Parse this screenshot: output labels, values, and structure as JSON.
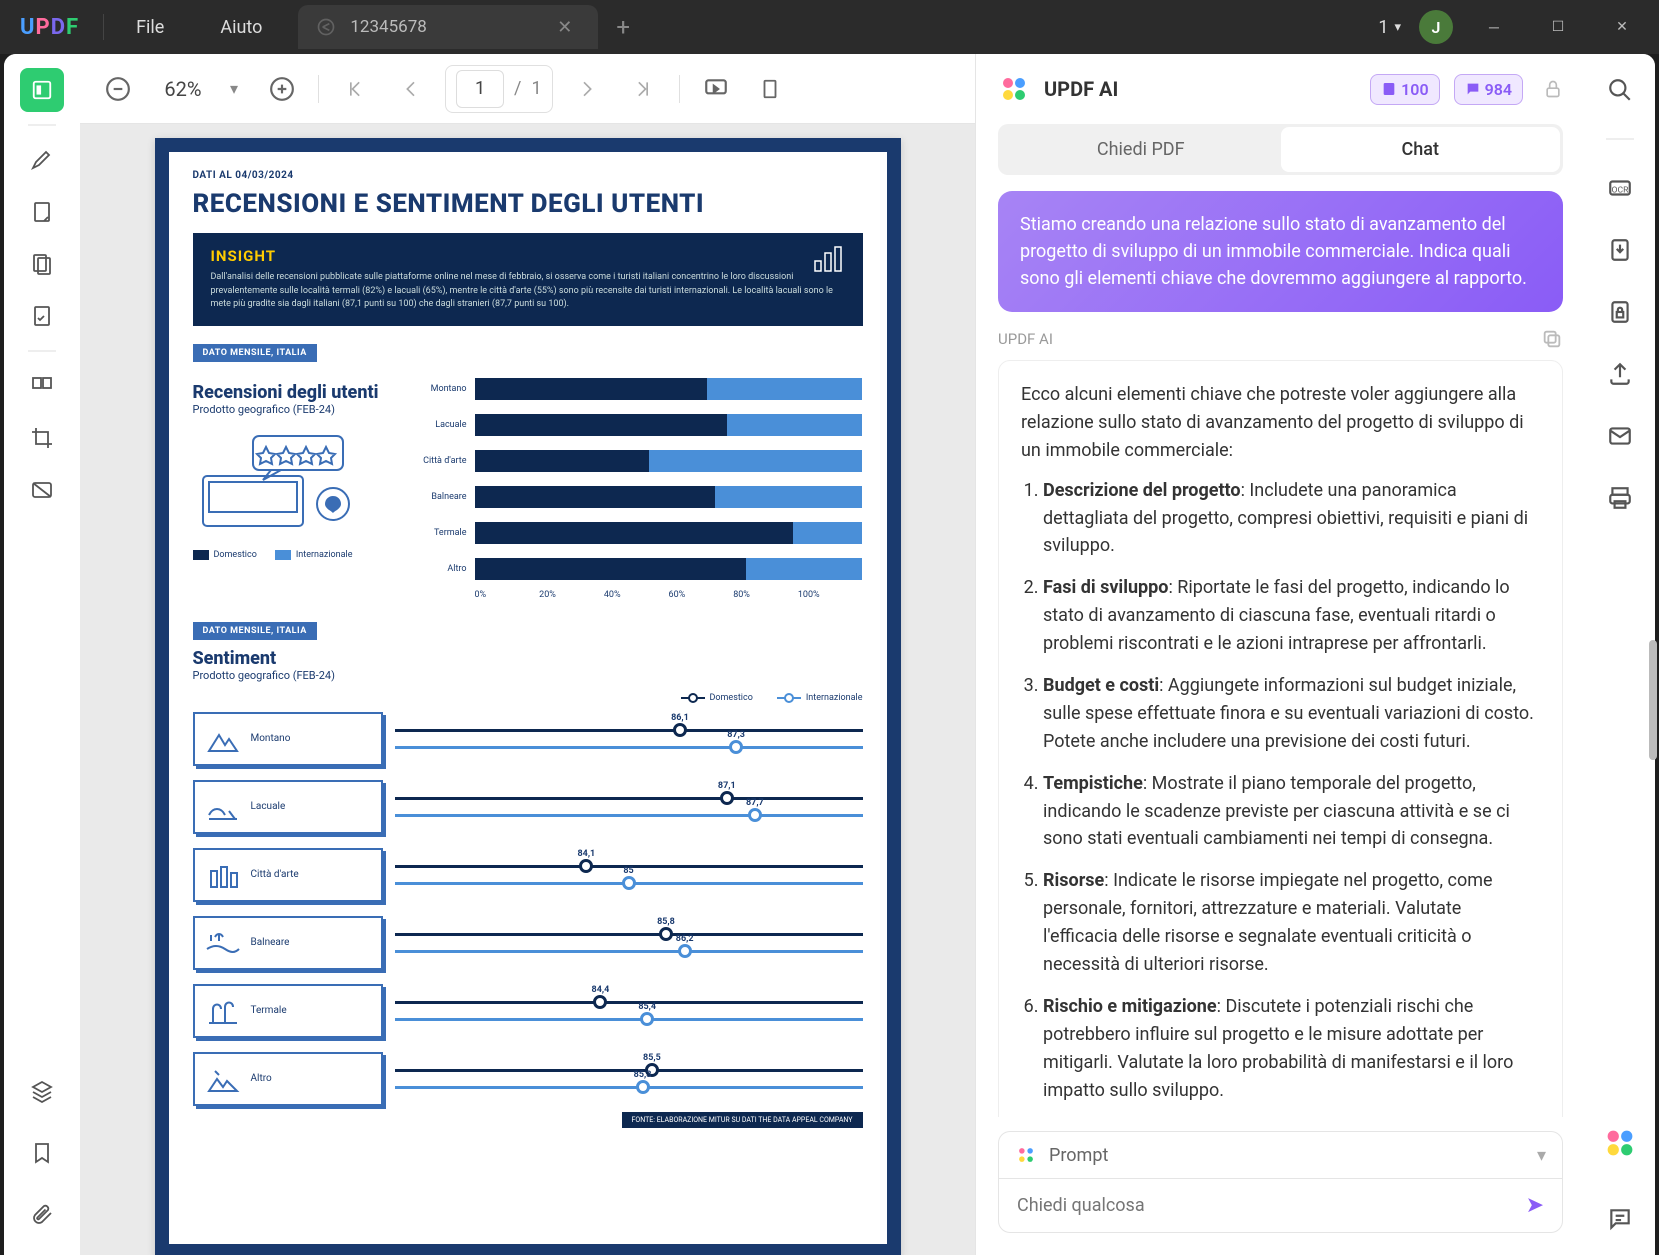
{
  "app": {
    "logo": "UPDF",
    "menu": {
      "file": "File",
      "help": "Aiuto"
    },
    "tab": {
      "title": "12345678"
    },
    "doc_counter": "1",
    "avatar_letter": "J"
  },
  "toolbar": {
    "zoom": "62%",
    "page_current": "1",
    "page_sep": "/",
    "page_total": "1"
  },
  "pdf": {
    "date": "DATI AL 04/03/2024",
    "title": "RECENSIONI E SENTIMENT DEGLI UTENTI",
    "insight_title": "INSIGHT",
    "insight_text": "Dall'analisi delle recensioni pubblicate sulle piattaforme online nel mese di febbraio, si osserva come i turisti italiani concentrino le loro discussioni prevalentemente sulle località termali (82%) e lacuali (65%), mentre le città d'arte (55%) sono più recensite dai turisti internazionali. Le località lacuali sono le mete più gradite sia dagli italiani (87,1 punti su 100) che dagli stranieri (87,7 punti su 100).",
    "tag": "DATO MENSILE, ITALIA",
    "reviews_title": "Recensioni degli utenti",
    "reviews_sub": "Prodotto geografico (FEB-24)",
    "sentiment_title": "Sentiment",
    "sentiment_sub": "Prodotto geografico (FEB-24)",
    "legend_domestic": "Domestico",
    "legend_intl": "Internazionale",
    "source": "FONTE: ELABORAZIONE MITUR SU DATI THE DATA APPEAL COMPANY",
    "axis": [
      "0%",
      "20%",
      "40%",
      "60%",
      "80%",
      "100%"
    ]
  },
  "chart_data": {
    "reviews": {
      "type": "bar",
      "categories": [
        "Montano",
        "Lacuale",
        "Città d'arte",
        "Balneare",
        "Termale",
        "Altro"
      ],
      "series": [
        {
          "name": "Domestico",
          "values": [
            60,
            65,
            45,
            62,
            82,
            70
          ],
          "color": "#0d2850"
        },
        {
          "name": "Internazionale",
          "values": [
            40,
            35,
            55,
            38,
            18,
            30
          ],
          "color": "#4a8fd8"
        }
      ],
      "xlabel": "",
      "ylabel": "",
      "ylim": [
        0,
        100
      ]
    },
    "sentiment": {
      "type": "dot",
      "categories": [
        "Montano",
        "Lacuale",
        "Città d'arte",
        "Balneare",
        "Termale",
        "Altro"
      ],
      "series": [
        {
          "name": "Domestico",
          "values": [
            86.1,
            87.1,
            84.1,
            85.8,
            84.4,
            85.5
          ],
          "color": "#0d2850"
        },
        {
          "name": "Internazionale",
          "values": [
            87.3,
            87.7,
            85.0,
            86.2,
            85.4,
            85.3
          ],
          "color": "#4a8fd8"
        }
      ],
      "range": [
        80,
        90
      ]
    }
  },
  "ai": {
    "title": "UPDF AI",
    "badge1": "100",
    "badge2": "984",
    "tab_ask": "Chiedi PDF",
    "tab_chat": "Chat",
    "user_message": "Stiamo creando una relazione sullo stato di avanzamento del progetto di sviluppo di un immobile commerciale. Indica quali sono gli elementi chiave che dovremmo aggiungere al rapporto.",
    "response_label": "UPDF AI",
    "response_intro": "Ecco alcuni elementi chiave che potreste voler aggiungere alla relazione sullo stato di avanzamento del progetto di sviluppo di un immobile commerciale:",
    "items": [
      {
        "t": "Descrizione del progetto",
        "b": ": Includete una panoramica dettagliata del progetto, compresi obiettivi, requisiti e piani di sviluppo."
      },
      {
        "t": "Fasi di sviluppo",
        "b": ": Riportate le fasi del progetto, indicando lo stato di avanzamento di ciascuna fase, eventuali ritardi o problemi riscontrati e le azioni intraprese per affrontarli."
      },
      {
        "t": "Budget e costi",
        "b": ": Aggiungete informazioni sul budget iniziale, sulle spese effettuate finora e su eventuali variazioni di costo. Potete anche includere una previsione dei costi futuri."
      },
      {
        "t": "Tempistiche",
        "b": ": Mostrate il piano temporale del progetto, indicando le scadenze previste per ciascuna attività e se ci sono stati eventuali cambiamenti nei tempi di consegna."
      },
      {
        "t": "Risorse",
        "b": ": Indicate le risorse impiegate nel progetto, come personale, fornitori, attrezzature e materiali. Valutate l'efficacia delle risorse e segnalate eventuali criticità o necessità di ulteriori risorse."
      },
      {
        "t": "Rischio e mitigazione",
        "b": ": Discutete i potenziali rischi che potrebbero influire sul progetto e le misure adottate per mitigarli. Valutate la loro probabilità di manifestarsi e il loro impatto sullo sviluppo."
      }
    ],
    "prompt_label": "Prompt",
    "input_placeholder": "Chiedi qualcosa"
  },
  "colors": {
    "navy": "#0d2850",
    "blue": "#4a8fd8",
    "accent": "#8a5cf6"
  }
}
